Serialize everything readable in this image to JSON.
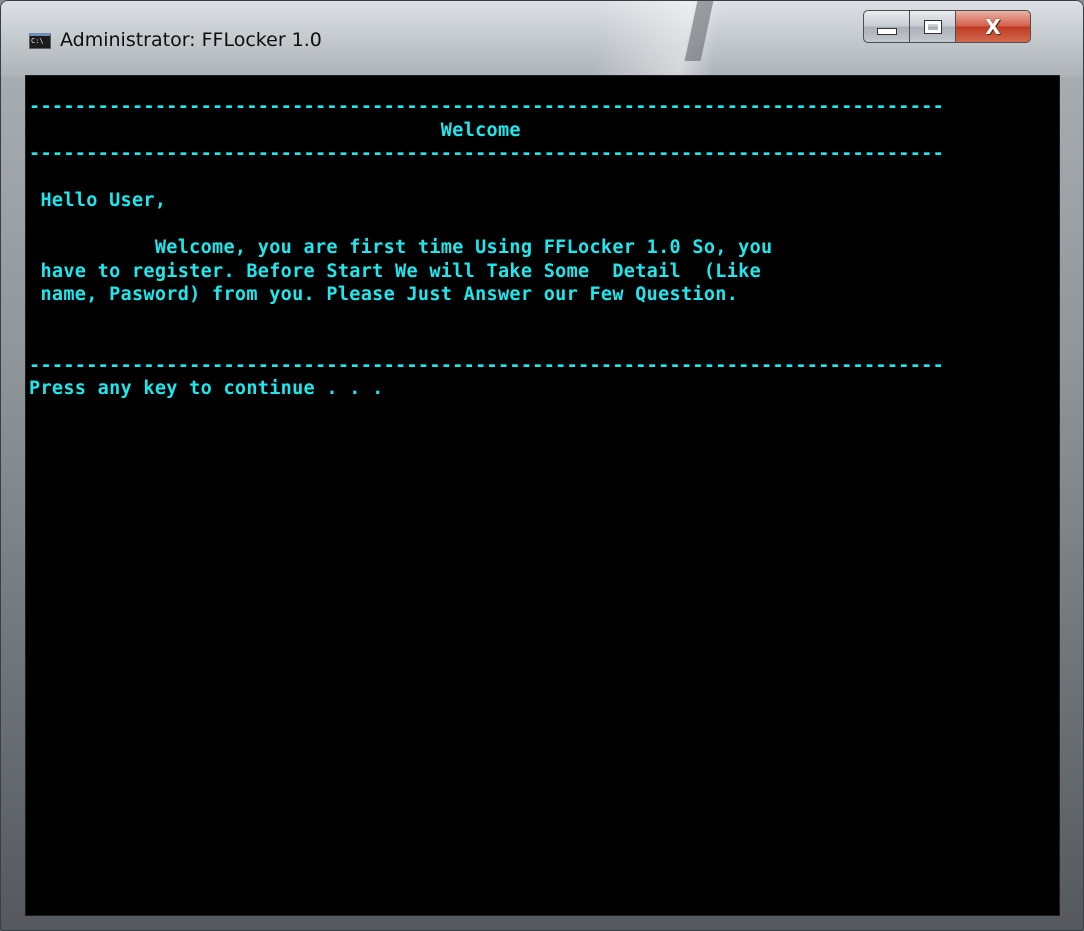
{
  "window": {
    "title": "Administrator:  FFLocker 1.0",
    "icon": "cmd-console-icon",
    "icon_text": "C:\\",
    "close_glyph": "X"
  },
  "console": {
    "text_color": "#1ee8ee",
    "background": "#000000",
    "lines": [
      "--------------------------------------------------------------------------------",
      "                                    Welcome",
      "--------------------------------------------------------------------------------",
      "",
      " Hello User,",
      "",
      "           Welcome, you are first time Using FFLocker 1.0 So, you",
      " have to register. Before Start We will Take Some  Detail  (Like",
      " name, Pasword) from you. Please Just Answer our Few Question.",
      "",
      "",
      "--------------------------------------------------------------------------------",
      "Press any key to continue . . ."
    ]
  }
}
